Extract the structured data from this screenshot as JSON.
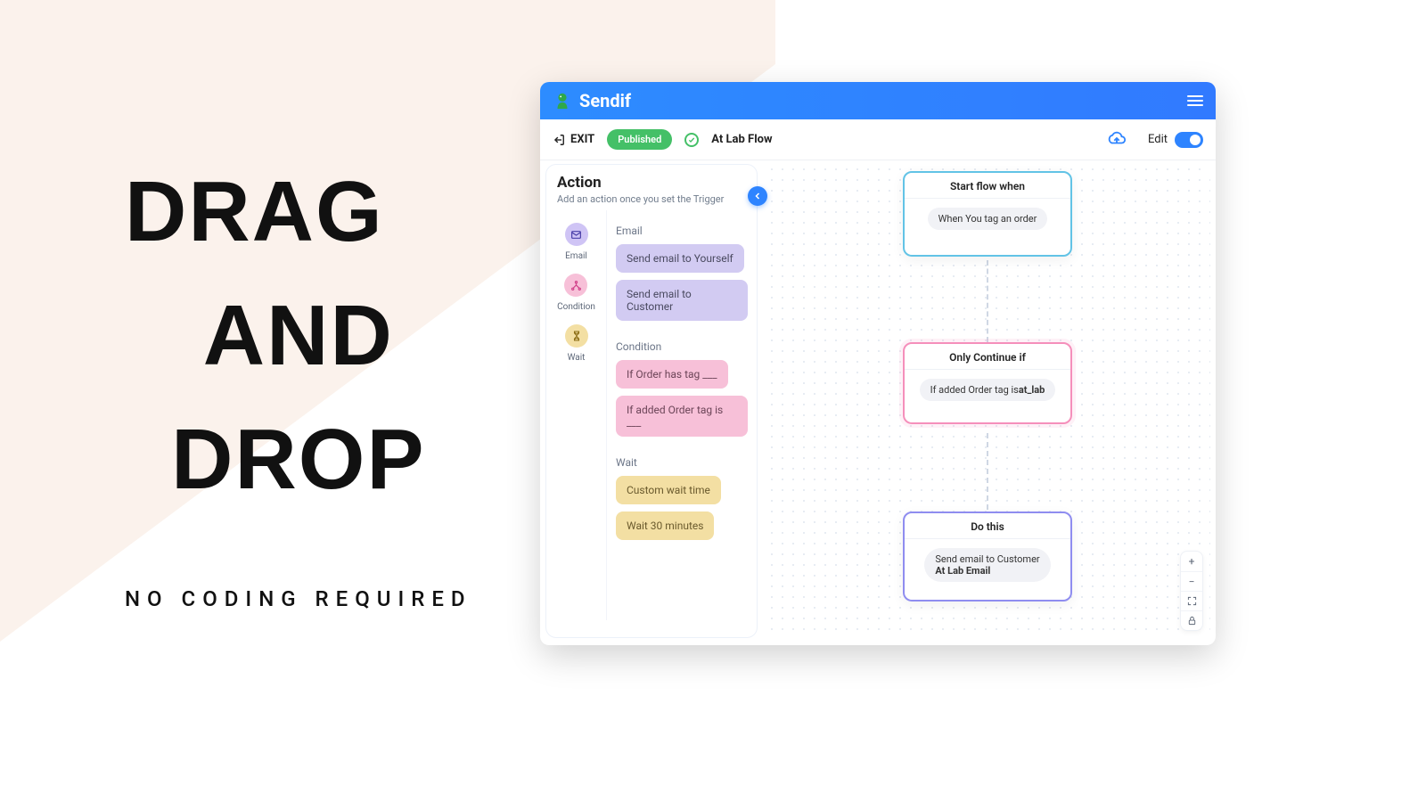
{
  "marketing": {
    "line1": "DRAG",
    "line2": "AND",
    "line3": "DROP",
    "tagline": "NO CODING REQUIRED"
  },
  "header": {
    "brand": "Sendif"
  },
  "toolbar": {
    "exit_label": "EXIT",
    "status_label": "Published",
    "flow_name": "At Lab Flow",
    "edit_label": "Edit"
  },
  "panel": {
    "title": "Action",
    "subtitle": "Add an action once you set the Trigger",
    "categories": {
      "email": "Email",
      "condition": "Condition",
      "wait": "Wait"
    },
    "sections": {
      "email_title": "Email",
      "email_items": [
        "Send email to Yourself",
        "Send email to Customer"
      ],
      "condition_title": "Condition",
      "condition_items": [
        "If Order has tag ___",
        "If added Order tag is ___"
      ],
      "wait_title": "Wait",
      "wait_items": [
        "Custom wait time",
        "Wait 30 minutes"
      ]
    }
  },
  "flow": {
    "trigger": {
      "title": "Start flow when",
      "pill": "When You tag an order"
    },
    "condition": {
      "title": "Only Continue if",
      "pill_prefix": "If added Order tag is ",
      "pill_bold": "at_lab"
    },
    "action": {
      "title": "Do this",
      "pill_line1": "Send email to Customer",
      "pill_line2": "At Lab Email"
    }
  }
}
